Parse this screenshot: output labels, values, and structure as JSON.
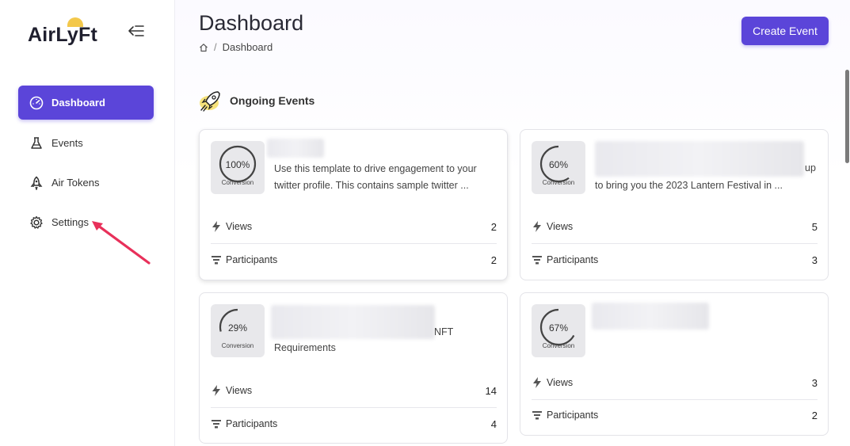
{
  "brand": {
    "name": "AirLyFt"
  },
  "sidebar": {
    "items": [
      {
        "label": "Dashboard",
        "active": true,
        "icon": "gauge-icon"
      },
      {
        "label": "Events",
        "active": false,
        "icon": "flask-icon"
      },
      {
        "label": "Air Tokens",
        "active": false,
        "icon": "rocket-icon"
      },
      {
        "label": "Settings",
        "active": false,
        "icon": "gear-icon"
      }
    ]
  },
  "header": {
    "title": "Dashboard",
    "breadcrumb": {
      "separator": "/",
      "current": "Dashboard"
    },
    "create_button": "Create Event"
  },
  "section": {
    "title": "Ongoing Events"
  },
  "events": [
    {
      "conversion": "100%",
      "conversion_value": 1.0,
      "conversion_label": "Conversion",
      "desc_line1": "Use this template to drive engagement to your",
      "desc_line2": "twitter profile. This contains sample twitter ...",
      "views_label": "Views",
      "views": "2",
      "participants_label": "Participants",
      "participants": "2"
    },
    {
      "conversion": "60%",
      "conversion_value": 0.6,
      "conversion_label": "Conversion",
      "desc_tail": "up",
      "desc_line2": "to bring you the 2023 Lantern Festival in ...",
      "views_label": "Views",
      "views": "5",
      "participants_label": "Participants",
      "participants": "3"
    },
    {
      "conversion": "29%",
      "conversion_value": 0.29,
      "conversion_label": "Conversion",
      "desc_tail": "NFT",
      "desc_line2": "Requirements",
      "views_label": "Views",
      "views": "14",
      "participants_label": "Participants",
      "participants": "4"
    },
    {
      "conversion": "67%",
      "conversion_value": 0.67,
      "conversion_label": "Conversion",
      "views_label": "Views",
      "views": "3",
      "participants_label": "Participants",
      "participants": "2"
    }
  ],
  "colors": {
    "accent": "#5b45d9",
    "annotation_arrow": "#e8305a"
  }
}
